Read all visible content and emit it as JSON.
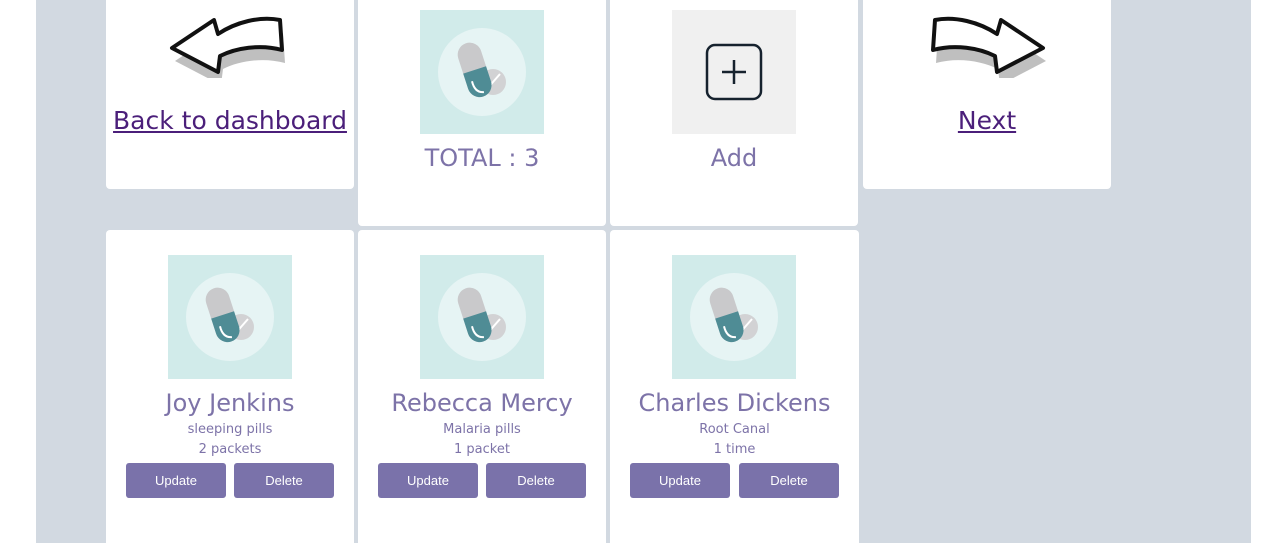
{
  "nav": {
    "back_label": "Back to dashboard",
    "next_label": "Next"
  },
  "summary": {
    "total_label": "TOTAL : 3",
    "add_label": "Add"
  },
  "records": [
    {
      "name": "Joy Jenkins",
      "item": "sleeping pills",
      "quantity": "2 packets",
      "update_label": "Update",
      "delete_label": "Delete"
    },
    {
      "name": "Rebecca Mercy",
      "item": "Malaria pills",
      "quantity": "1 packet",
      "update_label": "Update",
      "delete_label": "Delete"
    },
    {
      "name": "Charles Dickens",
      "item": "Root Canal",
      "quantity": "1 time",
      "update_label": "Update",
      "delete_label": "Delete"
    }
  ],
  "colors": {
    "page_bg": "#d2d9e1",
    "card_bg": "#ffffff",
    "link": "#4b1f7a",
    "text_accent": "#7d73a8",
    "button": "#7a72aa",
    "thumb_bg": "#d1ebea"
  },
  "icons": {
    "back": "curved-arrow-left-icon",
    "next": "curved-arrow-right-icon",
    "medicine": "pill-capsule-icon",
    "add": "plus-square-icon"
  }
}
